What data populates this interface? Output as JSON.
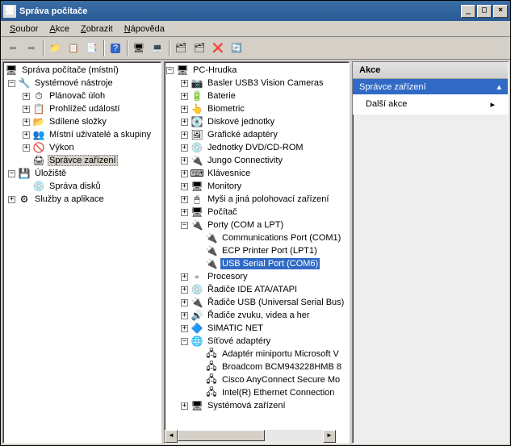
{
  "window": {
    "title": "Správa počítače",
    "btn_min": "_",
    "btn_max": "□",
    "btn_close": "×"
  },
  "menu": {
    "file": "Soubor",
    "action": "Akce",
    "view": "Zobrazit",
    "help": "Nápověda"
  },
  "left_tree": {
    "root": "Správa počítače (místní)",
    "systools": "Systémové nástroje",
    "scheduler": "Plánovač úloh",
    "events": "Prohlížeč událostí",
    "shared": "Sdílené složky",
    "users": "Místní uživatelé a skupiny",
    "perf": "Výkon",
    "devmgr": "Správce zařízení",
    "storage": "Úložiště",
    "diskmgr": "Správa disků",
    "services": "Služby a aplikace"
  },
  "mid_tree": {
    "root": "PC-Hrudka",
    "items": [
      "Basler USB3 Vision Cameras",
      "Baterie",
      "Biometric",
      "Diskové jednotky",
      "Grafické adaptéry",
      "Jednotky DVD/CD-ROM",
      "Jungo Connectivity",
      "Klávesnice",
      "Monitory",
      "Myši a jiná polohovací zařízení",
      "Počítač"
    ],
    "ports": "Porty (COM a LPT)",
    "port_com1": "Communications Port (COM1)",
    "port_lpt1": "ECP Printer Port (LPT1)",
    "port_usb": "USB Serial Port (COM6)",
    "cpu": "Procesory",
    "ide": "Řadiče IDE ATA/ATAPI",
    "usb": "Řadiče USB (Universal Serial Bus)",
    "sound": "Řadiče zvuku, videa a her",
    "simatic": "SIMATIC NET",
    "net": "Síťové adaptéry",
    "net1": "Adaptér miniportu Microsoft V",
    "net2": "Broadcom BCM943228HMB 8",
    "net3": "Cisco AnyConnect Secure Mo",
    "net4": "Intel(R) Ethernet Connection",
    "sysdev": "Systémová zařízení"
  },
  "right": {
    "header": "Akce",
    "sub": "Správce zařízení",
    "item": "Další akce"
  }
}
